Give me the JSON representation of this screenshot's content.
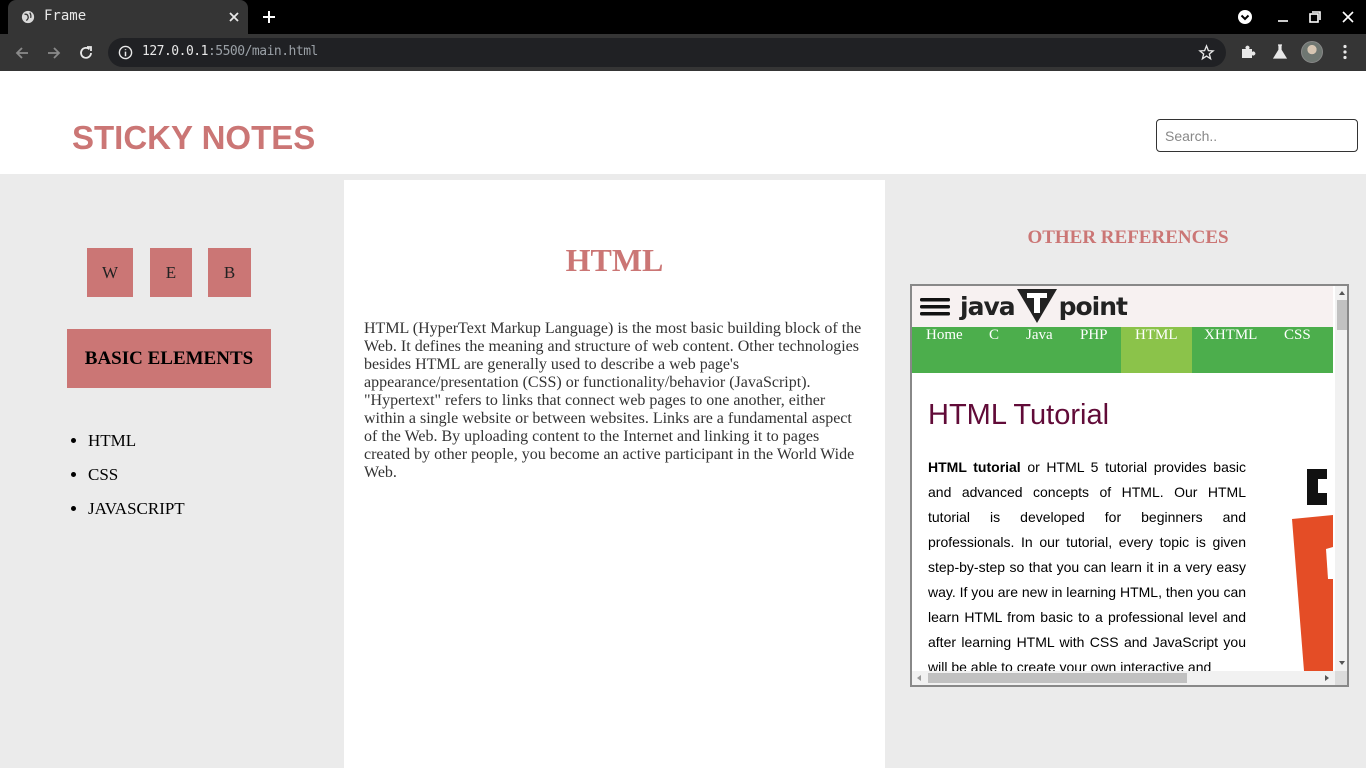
{
  "browser": {
    "tab_title": "Frame",
    "url_host": "127.0.0.1",
    "url_path": ":5500/main.html"
  },
  "header": {
    "title": "STICKY NOTES",
    "search_placeholder": "Search.."
  },
  "left": {
    "letters": [
      "W",
      "E",
      "B"
    ],
    "section_title": "BASIC ELEMENTS",
    "items": [
      "HTML",
      "CSS",
      "JAVASCRIPT"
    ]
  },
  "center": {
    "title": "HTML",
    "paragraph": "HTML (HyperText Markup Language) is the most basic building block of the Web. It defines the meaning and structure of web content. Other technologies besides HTML are generally used to describe a web page's appearance/presentation (CSS) or functionality/behavior (JavaScript). \"Hypertext\" refers to links that connect web pages to one another, either within a single website or between websites. Links are a fundamental aspect of the Web. By uploading content to the Internet and linking it to pages created by other people, you become an active participant in the World Wide Web."
  },
  "right": {
    "title": "OTHER REFERENCES",
    "frame": {
      "logo_left": "java",
      "logo_right": "point",
      "nav": [
        "Home",
        "C",
        "Java",
        "PHP",
        "HTML",
        "XHTML",
        "CSS"
      ],
      "active_nav": "HTML",
      "heading": "HTML Tutorial",
      "para_bold": "HTML tutorial",
      "para_rest": " or HTML 5 tutorial provides basic and advanced concepts of HTML. Our HTML tutorial is developed for beginners and professionals. In our tutorial, every topic is given step-by-step so that you can learn it in a very easy way. If you are new in learning HTML, then you can learn HTML from basic to a professional level and after learning HTML with CSS and JavaScript you will be able to create your own interactive and"
    }
  },
  "colors": {
    "accent": "#cb7675",
    "nav_green": "#4cae4c",
    "nav_active": "#8bc34a",
    "heading_maroon": "#610b38"
  }
}
